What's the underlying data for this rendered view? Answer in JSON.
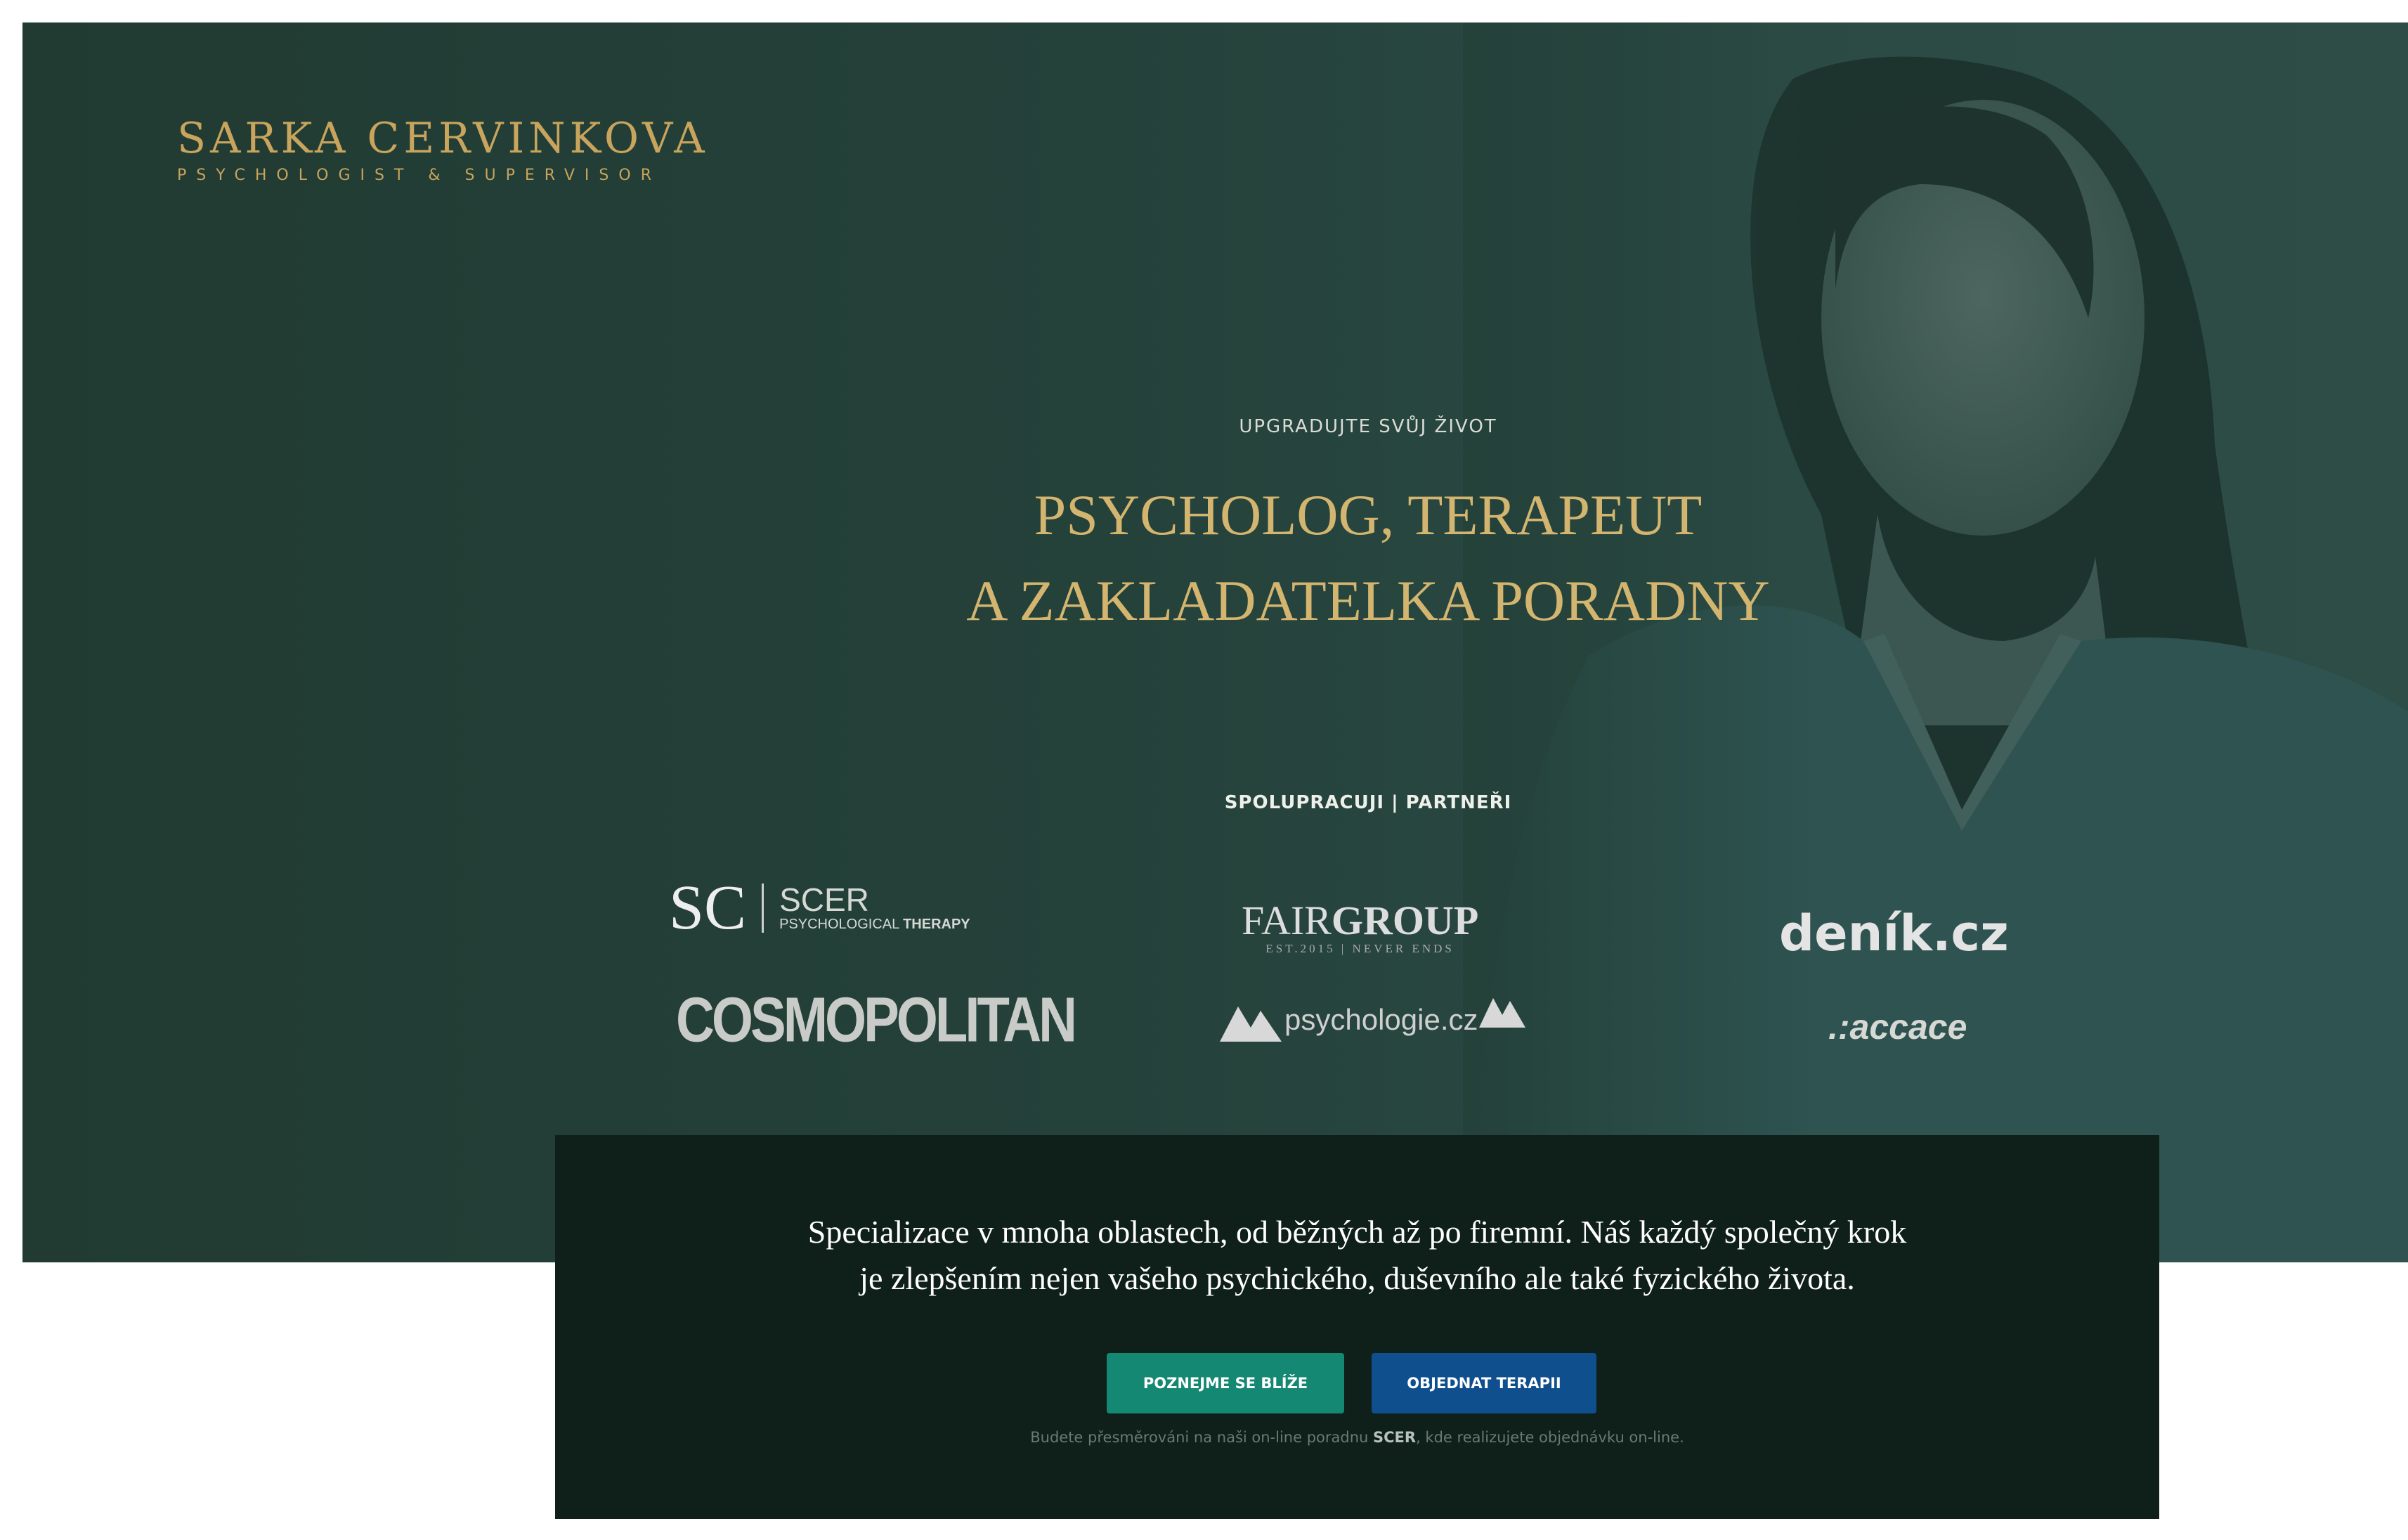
{
  "brand": {
    "name": "SARKA CERVINKOVA",
    "tagline": "PSYCHOLOGIST & SUPERVISOR"
  },
  "hero": {
    "eyebrow": "UPGRADUJTE SVŮJ ŽIVOT",
    "headline_line1": "PSYCHOLOG, TERAPEUT",
    "headline_line2": "A ZAKLADATELKA PORADNY"
  },
  "partners": {
    "title": "SPOLUPRACUJI | PARTNEŘI",
    "scer": {
      "monogram": "SC",
      "name": "SCER",
      "sub_light": "PSYCHOLOGICAL",
      "sub_bold": "THERAPY"
    },
    "fairgroup": {
      "light": "FAIR",
      "bold": "GROUP",
      "sub": "EST.2015 | NEVER ENDS"
    },
    "denik": "deník.cz",
    "cosmopolitan": "COSMOPOLITAN",
    "psychologie": "psychologie.cz",
    "accace": ".:accace"
  },
  "intro": {
    "line1": "Specializace v mnoha oblastech, od běžných až po firemní. Náš každý společný krok",
    "line2": "je zlepšením nejen vašeho psychického, duševního ale také fyzického života.",
    "button_primary": "POZNEJME SE BLÍŽE",
    "button_secondary": "OBJEDNAT TERAPII",
    "note_before": "Budete přesměrováni na naši on-line poradnu ",
    "note_bold": "SCER",
    "note_after": ", kde realizujete objednávku on-line."
  },
  "colors": {
    "hero_bg": "#24413a",
    "gold": "#d3b56f",
    "card_bg": "#0f1f1a",
    "button_green": "#148872",
    "button_blue": "#0f4f8e"
  }
}
